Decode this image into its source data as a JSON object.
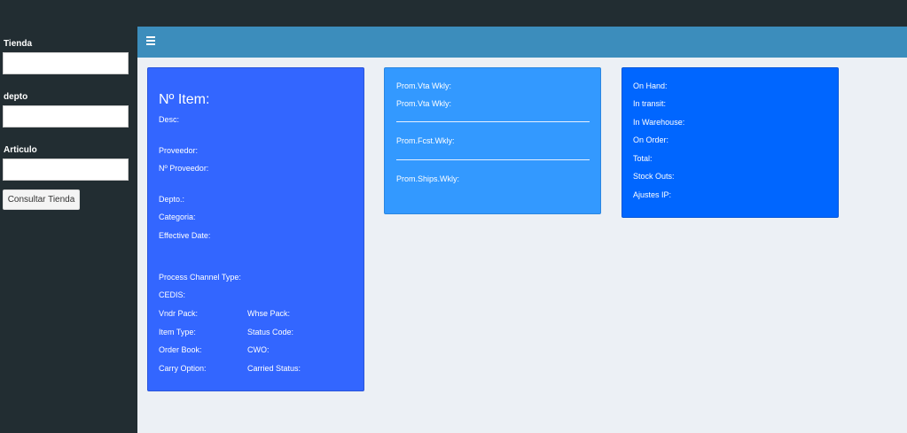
{
  "sidebar": {
    "tienda_label": "Tienda",
    "depto_label": "depto",
    "articulo_label": "Articulo",
    "tienda_value": "",
    "depto_value": "",
    "articulo_value": "",
    "consultar_button": "Consultar Tienda"
  },
  "header": {
    "menu_icon": "hamburger-icon"
  },
  "item_card": {
    "title": "Nº Item:",
    "desc": "Desc:",
    "proveedor": "Proveedor:",
    "no_proveedor": "Nº Proveedor:",
    "depto": "Depto.:",
    "categoria": "Categoria:",
    "effective_date": "Effective Date:",
    "process_channel_type": "Process Channel Type:",
    "cedis": "CEDIS:",
    "vndr_pack": "Vndr Pack:",
    "whse_pack": "Whse Pack:",
    "item_type": "Item Type:",
    "status_code": "Status Code:",
    "order_book": "Order Book:",
    "cwo": "CWO:",
    "carry_option": "Carry Option:",
    "carried_status": "Carried Status:"
  },
  "sales_card": {
    "prom_vta_wkly_1": "Prom.Vta Wkly:",
    "prom_vta_wkly_2": "Prom.Vta Wkly:",
    "prom_fcst_wkly": "Prom.Fcst.Wkly:",
    "prom_ships_wkly": "Prom.Ships.Wkly:"
  },
  "inventory_card": {
    "on_hand": "On Hand:",
    "in_transit": "In transit:",
    "in_warehouse": "In Warehouse:",
    "on_order": "On Order:",
    "total": "Total:",
    "stock_outs": "Stock Outs:",
    "ajustes_ip": "Ajustes IP:"
  },
  "colors": {
    "sidebar_bg": "#222d32",
    "header_bg": "#3c8dbc",
    "content_bg": "#ecf0f5",
    "item_card_bg": "#3366ff",
    "sales_card_bg": "#3399ff",
    "inventory_card_bg": "#0066ff"
  }
}
